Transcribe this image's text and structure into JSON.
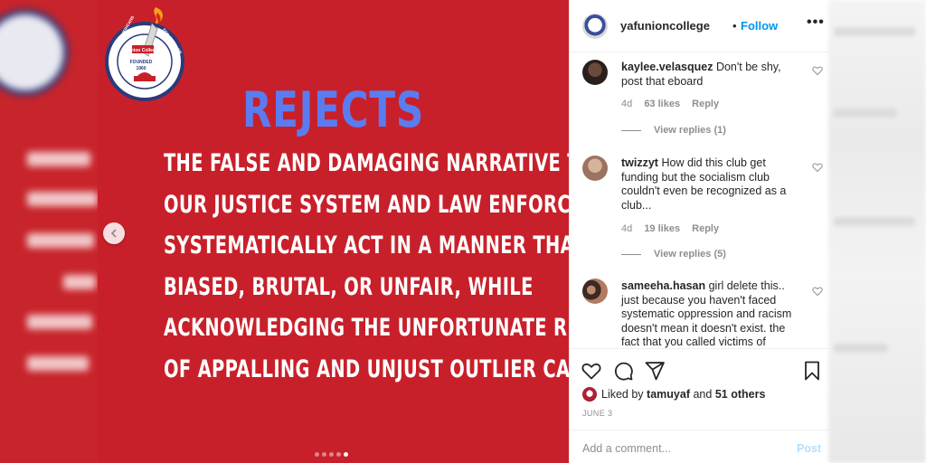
{
  "post": {
    "headline": "REJECTS",
    "body_lines": [
      "THE FALSE AND DAMAGING NARRATIVE THAT",
      "OUR JUSTICE SYSTEM AND LAW ENFORCEMENT",
      "SYSTEMATICALLY ACT IN A MANNER THAT IS",
      "BIASED, BRUTAL, OR UNFAIR, WHILE",
      "ACKNOWLEDGING THE UNFORTUNATE REALITY",
      "OF APPALLING AND UNJUST OUTLIER CASES"
    ],
    "logo": {
      "ring_top": "YOUNG AMERICANS",
      "ring_right": "FOR FREEDOM",
      "center_name": "Union College",
      "founded": "FOUNDED",
      "year": "1960",
      "url": "WWW.YAF.ORG"
    },
    "carousel_count": 5,
    "carousel_active_index": 4,
    "colors": {
      "background": "#c8202a",
      "headline": "#5b7cf0",
      "body": "#ffffff"
    }
  },
  "header": {
    "username": "yafunioncollege",
    "separator": "•",
    "follow_label": "Follow",
    "more_icon": "•••"
  },
  "comments": [
    {
      "username": "kaylee.velasquez",
      "text": "Don't be shy, post that eboard",
      "age": "4d",
      "likes": "63 likes",
      "reply_label": "Reply",
      "view_replies": "View replies (1)"
    },
    {
      "username": "twizzyt",
      "text": "How did this club get funding but the socialism club couldn't even be recognized as a club...",
      "age": "4d",
      "likes": "19 likes",
      "reply_label": "Reply",
      "view_replies": "View replies (5)"
    },
    {
      "username": "sameeha.hasan",
      "text": "girl delete this.. just because you haven't faced systematic oppression and racism doesn't mean it doesn't exist. the fact that you called victims of"
    }
  ],
  "actions": {
    "liked_by_prefix": "Liked by",
    "liked_by_user": "tamuyaf",
    "liked_by_and": "and",
    "liked_by_others": "51 others",
    "date": "JUNE 3"
  },
  "add_comment": {
    "placeholder": "Add a comment...",
    "post_label": "Post"
  },
  "colors": {
    "link": "#0095f6",
    "muted": "#8e8e8e",
    "text": "#262626",
    "post_disabled": "#b2dffc"
  }
}
